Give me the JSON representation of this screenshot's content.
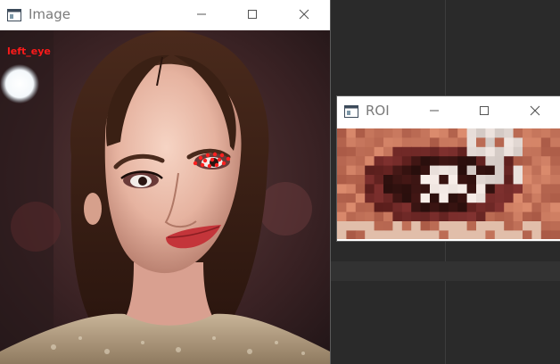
{
  "windows": {
    "image": {
      "title": "Image",
      "overlay_label": "left_eye"
    },
    "roi": {
      "title": "ROI"
    }
  },
  "controls": {
    "minimize_icon": "minimize-icon",
    "maximize_icon": "maximize-icon",
    "close_icon": "close-icon"
  },
  "colors": {
    "landmark": "#ff2020",
    "label": "#ff1a1a"
  }
}
